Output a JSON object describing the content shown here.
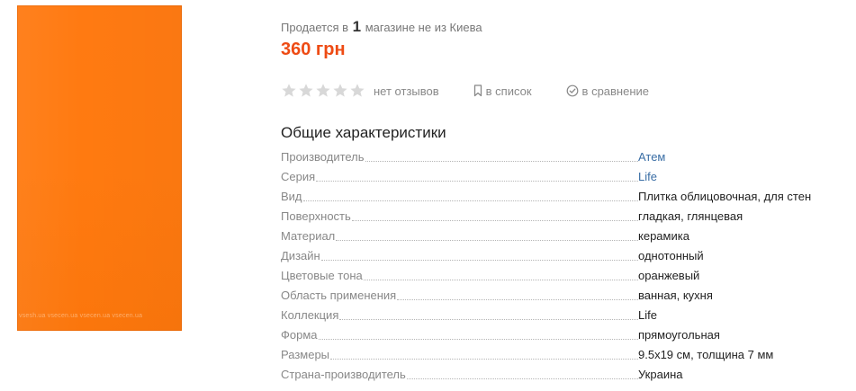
{
  "image": {
    "watermark": "vsesh.ua  vsecen.ua  vsecen.ua  vsecen.ua"
  },
  "availability": {
    "prefix": "Продается в",
    "count": "1",
    "suffix": "магазине не из Киева"
  },
  "price": "360 грн",
  "rating": {
    "stars_filled": 0,
    "stars_total": 5,
    "reviews_label": "нет отзывов"
  },
  "actions": {
    "list_label": "в список",
    "compare_label": "в сравнение"
  },
  "colors": {
    "price": "#ee4b14",
    "link": "#3a6ea5",
    "tile": "#ff7a12",
    "star": "#d8d8d8"
  },
  "specs": {
    "title": "Общие характеристики",
    "rows": [
      {
        "name": "Производитель",
        "value": "Атем",
        "link": true
      },
      {
        "name": "Серия",
        "value": "Life",
        "link": true
      },
      {
        "name": "Вид",
        "value": "Плитка облицовочная, для стен",
        "link": false
      },
      {
        "name": "Поверхность",
        "value": "гладкая, глянцевая",
        "link": false
      },
      {
        "name": "Материал",
        "value": "керамика",
        "link": false
      },
      {
        "name": "Дизайн",
        "value": "однотонный",
        "link": false
      },
      {
        "name": "Цветовые тона",
        "value": "оранжевый",
        "link": false
      },
      {
        "name": "Область применения",
        "value": "ванная, кухня",
        "link": false
      },
      {
        "name": "Коллекция",
        "value": "Life",
        "link": false
      },
      {
        "name": "Форма",
        "value": "прямоугольная",
        "link": false
      },
      {
        "name": "Размеры",
        "value": "9.5х19 см, толщина 7 мм",
        "link": false
      },
      {
        "name": "Страна-производитель",
        "value": "Украина",
        "link": false
      }
    ]
  }
}
